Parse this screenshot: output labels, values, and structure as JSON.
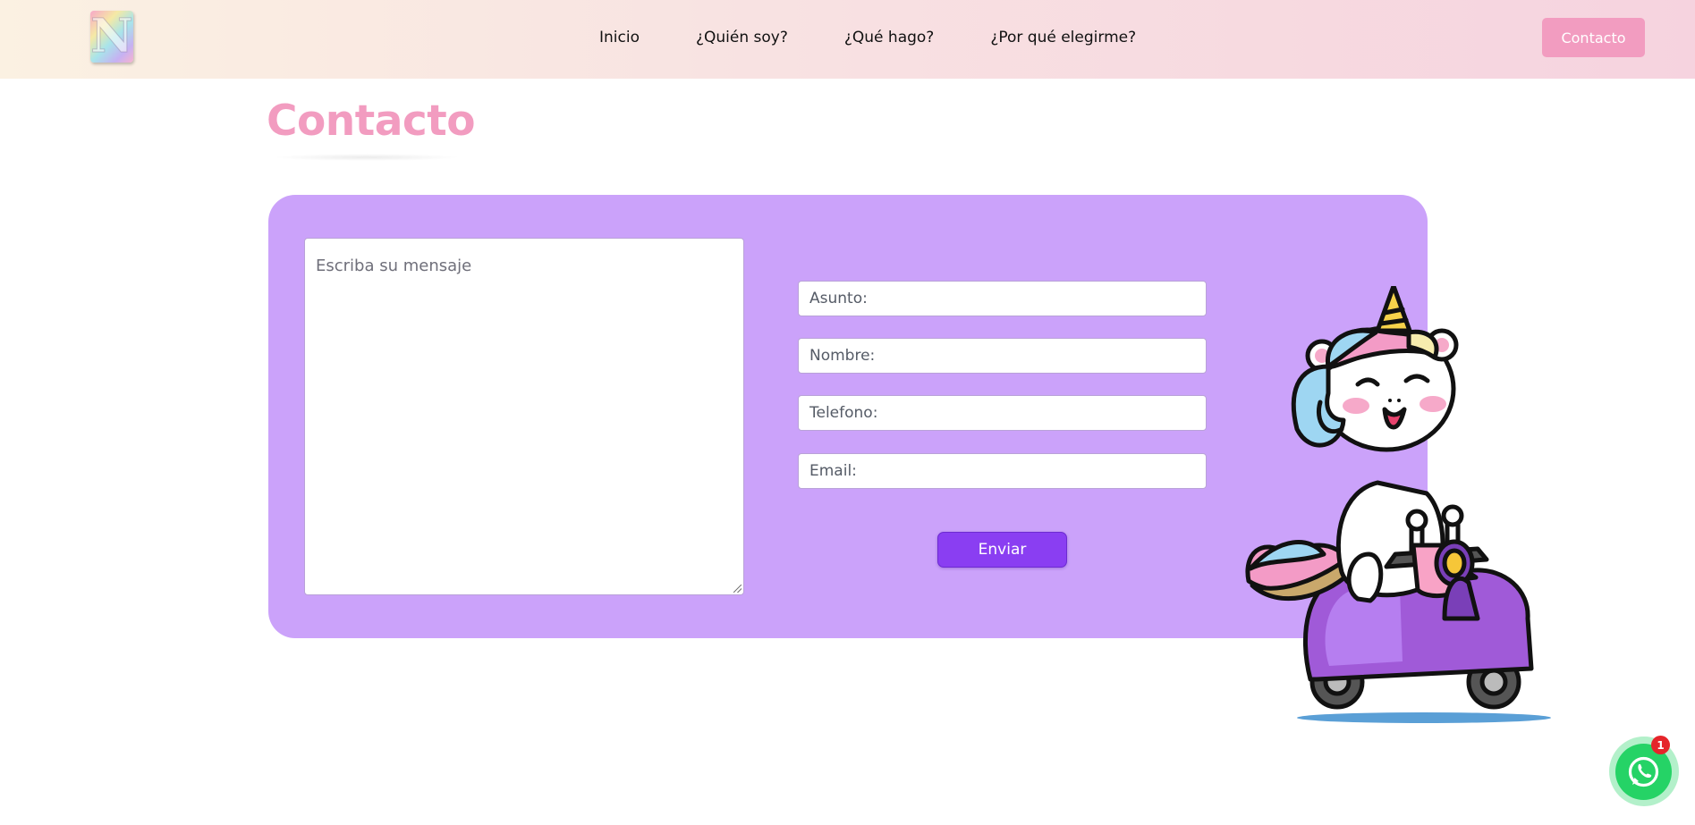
{
  "header": {
    "logo_letter": "N",
    "nav": {
      "inicio": "Inicio",
      "quien_soy": "¿Quién soy?",
      "que_hago": "¿Qué hago?",
      "por_que": "¿Por qué elegirme?"
    },
    "cta_label": "Contacto"
  },
  "page": {
    "title": "Contacto"
  },
  "form": {
    "message_placeholder": "Escriba su mensaje",
    "subject_placeholder": "Asunto:",
    "name_placeholder": "Nombre:",
    "phone_placeholder": "Telefono:",
    "email_placeholder": "Email:",
    "submit_label": "Enviar"
  },
  "whatsapp": {
    "badge_count": "1"
  },
  "colors": {
    "accent_pink": "#f29cc0",
    "card_purple": "#cba2fa",
    "button_purple": "#8a3ef2",
    "whatsapp_green": "#25d366",
    "badge_red": "#e5252a"
  }
}
